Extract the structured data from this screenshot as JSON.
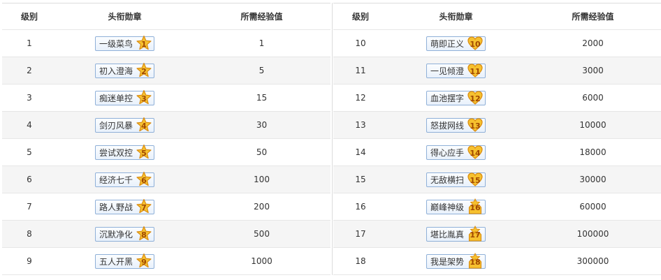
{
  "headers": {
    "level": "级别",
    "badge": "头衔勋章",
    "exp": "所需经验值"
  },
  "rows": [
    {
      "level": "1",
      "title": "一级菜鸟",
      "num": "1",
      "exp": "1",
      "shape": "star"
    },
    {
      "level": "2",
      "title": "初入澄海",
      "num": "2",
      "exp": "5",
      "shape": "star"
    },
    {
      "level": "3",
      "title": "痴迷单控",
      "num": "3",
      "exp": "15",
      "shape": "star"
    },
    {
      "level": "4",
      "title": "剑刃风暴",
      "num": "4",
      "exp": "30",
      "shape": "star"
    },
    {
      "level": "5",
      "title": "尝试双控",
      "num": "5",
      "exp": "50",
      "shape": "star"
    },
    {
      "level": "6",
      "title": "经济七千",
      "num": "6",
      "exp": "100",
      "shape": "star"
    },
    {
      "level": "7",
      "title": "路人野战",
      "num": "7",
      "exp": "200",
      "shape": "star"
    },
    {
      "level": "8",
      "title": "沉默净化",
      "num": "8",
      "exp": "500",
      "shape": "star"
    },
    {
      "level": "9",
      "title": "五人开黑",
      "num": "9",
      "exp": "1000",
      "shape": "star"
    },
    {
      "level": "10",
      "title": "萌即正义",
      "num": "10",
      "exp": "2000",
      "shape": "heart"
    },
    {
      "level": "11",
      "title": "一见倾澄",
      "num": "11",
      "exp": "3000",
      "shape": "heart"
    },
    {
      "level": "12",
      "title": "血池摆字",
      "num": "12",
      "exp": "6000",
      "shape": "heart"
    },
    {
      "level": "13",
      "title": "怒拔网线",
      "num": "13",
      "exp": "10000",
      "shape": "heart"
    },
    {
      "level": "14",
      "title": "得心应手",
      "num": "14",
      "exp": "18000",
      "shape": "heart"
    },
    {
      "level": "15",
      "title": "无敌横扫",
      "num": "15",
      "exp": "30000",
      "shape": "heart"
    },
    {
      "level": "16",
      "title": "巅峰神级",
      "num": "16",
      "exp": "60000",
      "shape": "crown"
    },
    {
      "level": "17",
      "title": "堪比胤真",
      "num": "17",
      "exp": "100000",
      "shape": "crown"
    },
    {
      "level": "18",
      "title": "我是架势",
      "num": "18",
      "exp": "300000",
      "shape": "crown"
    }
  ],
  "colors": {
    "badge_gold": "#f6c12f",
    "badge_gold_dark": "#d98a10",
    "badge_number": "#a04800",
    "badge_border": "#8fb0d8",
    "row_alt": "#f5f5f5"
  }
}
